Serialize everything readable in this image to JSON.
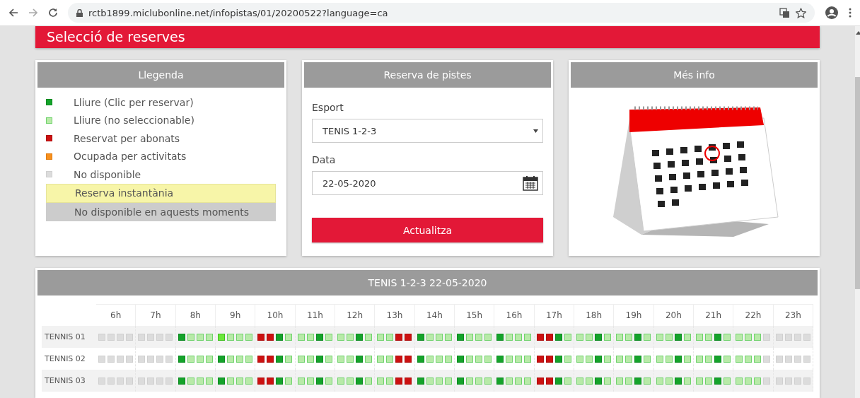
{
  "browser": {
    "url": "rctb1899.miclubonline.net/infopistas/01/20200522?language=ca"
  },
  "page_title": "Selecció de reserves",
  "legend": {
    "title": "Llegenda",
    "items": [
      {
        "kind": "free",
        "label": "Lliure (Clic per reservar)"
      },
      {
        "kind": "closed",
        "label": "Lliure (no seleccionable)"
      },
      {
        "kind": "booked",
        "label": "Reservat per abonats"
      },
      {
        "kind": "activity",
        "label": "Ocupada per activitats"
      },
      {
        "kind": "unavailable",
        "label": "No disponible"
      },
      {
        "kind": "instant",
        "label": "Reserva instantània"
      },
      {
        "kind": "blocked",
        "label": "No disponible en aquests moments"
      }
    ]
  },
  "booking": {
    "title": "Reserva de pistes",
    "sport_label": "Esport",
    "sport_value": "TENIS 1-2-3",
    "date_label": "Data",
    "date_value": "22-05-2020",
    "button": "Actualitza"
  },
  "info": {
    "title": "Més info"
  },
  "grid": {
    "title": "TENIS 1-2-3 22-05-2020",
    "hours": [
      "6h",
      "7h",
      "8h",
      "9h",
      "10h",
      "11h",
      "12h",
      "13h",
      "14h",
      "15h",
      "16h",
      "17h",
      "18h",
      "19h",
      "20h",
      "21h",
      "22h",
      "23h"
    ],
    "courts": [
      {
        "name": "TENNIS 01",
        "slots": [
          {
            "kind": "unavailable"
          },
          {
            "kind": "unavailable"
          },
          {
            "kind": "unavailable"
          },
          {
            "kind": "unavailable"
          },
          {
            "kind": "unavailable"
          },
          {
            "kind": "unavailable"
          },
          {
            "kind": "unavailable"
          },
          {
            "kind": "unavailable"
          },
          {
            "kind": "free"
          },
          {
            "kind": "closed"
          },
          {
            "kind": "closed"
          },
          {
            "kind": "closed"
          },
          {
            "kind": "highlight"
          },
          {
            "kind": "closed"
          },
          {
            "kind": "closed"
          },
          {
            "kind": "closed"
          },
          {
            "kind": "booked"
          },
          {
            "kind": "booked"
          },
          {
            "kind": "free"
          },
          {
            "kind": "closed"
          },
          {
            "kind": "closed"
          },
          {
            "kind": "closed"
          },
          {
            "kind": "free"
          },
          {
            "kind": "closed"
          },
          {
            "kind": "closed"
          },
          {
            "kind": "closed"
          },
          {
            "kind": "free"
          },
          {
            "kind": "closed"
          },
          {
            "kind": "closed"
          },
          {
            "kind": "closed"
          },
          {
            "kind": "booked"
          },
          {
            "kind": "booked"
          },
          {
            "kind": "free"
          },
          {
            "kind": "closed"
          },
          {
            "kind": "closed"
          },
          {
            "kind": "closed"
          },
          {
            "kind": "free"
          },
          {
            "kind": "closed"
          },
          {
            "kind": "closed"
          },
          {
            "kind": "closed"
          },
          {
            "kind": "free"
          },
          {
            "kind": "closed"
          },
          {
            "kind": "closed"
          },
          {
            "kind": "closed"
          },
          {
            "kind": "booked"
          },
          {
            "kind": "booked"
          },
          {
            "kind": "free"
          },
          {
            "kind": "closed"
          },
          {
            "kind": "closed"
          },
          {
            "kind": "closed"
          },
          {
            "kind": "free"
          },
          {
            "kind": "closed"
          },
          {
            "kind": "closed"
          },
          {
            "kind": "closed"
          },
          {
            "kind": "free"
          },
          {
            "kind": "closed"
          },
          {
            "kind": "closed"
          },
          {
            "kind": "closed"
          },
          {
            "kind": "free"
          },
          {
            "kind": "closed"
          },
          {
            "kind": "closed"
          },
          {
            "kind": "closed"
          },
          {
            "kind": "free"
          },
          {
            "kind": "closed"
          },
          {
            "kind": "closed"
          },
          {
            "kind": "closed"
          },
          {
            "kind": "closed"
          },
          {
            "kind": "unavailable"
          },
          {
            "kind": "unavailable"
          },
          {
            "kind": "unavailable"
          },
          {
            "kind": "unavailable"
          },
          {
            "kind": "unavailable"
          }
        ]
      },
      {
        "name": "TENNIS 02",
        "slots": [
          {
            "kind": "unavailable"
          },
          {
            "kind": "unavailable"
          },
          {
            "kind": "unavailable"
          },
          {
            "kind": "unavailable"
          },
          {
            "kind": "unavailable"
          },
          {
            "kind": "unavailable"
          },
          {
            "kind": "unavailable"
          },
          {
            "kind": "unavailable"
          },
          {
            "kind": "free"
          },
          {
            "kind": "closed"
          },
          {
            "kind": "closed"
          },
          {
            "kind": "closed"
          },
          {
            "kind": "free"
          },
          {
            "kind": "closed"
          },
          {
            "kind": "closed"
          },
          {
            "kind": "closed"
          },
          {
            "kind": "booked"
          },
          {
            "kind": "booked"
          },
          {
            "kind": "free"
          },
          {
            "kind": "closed"
          },
          {
            "kind": "closed"
          },
          {
            "kind": "closed"
          },
          {
            "kind": "free"
          },
          {
            "kind": "closed"
          },
          {
            "kind": "closed"
          },
          {
            "kind": "closed"
          },
          {
            "kind": "free"
          },
          {
            "kind": "closed"
          },
          {
            "kind": "closed"
          },
          {
            "kind": "closed"
          },
          {
            "kind": "booked"
          },
          {
            "kind": "booked"
          },
          {
            "kind": "free"
          },
          {
            "kind": "closed"
          },
          {
            "kind": "closed"
          },
          {
            "kind": "closed"
          },
          {
            "kind": "free"
          },
          {
            "kind": "closed"
          },
          {
            "kind": "closed"
          },
          {
            "kind": "closed"
          },
          {
            "kind": "free"
          },
          {
            "kind": "closed"
          },
          {
            "kind": "closed"
          },
          {
            "kind": "closed"
          },
          {
            "kind": "booked"
          },
          {
            "kind": "booked"
          },
          {
            "kind": "free"
          },
          {
            "kind": "closed"
          },
          {
            "kind": "closed"
          },
          {
            "kind": "closed"
          },
          {
            "kind": "free"
          },
          {
            "kind": "closed"
          },
          {
            "kind": "closed"
          },
          {
            "kind": "closed"
          },
          {
            "kind": "free"
          },
          {
            "kind": "closed"
          },
          {
            "kind": "closed"
          },
          {
            "kind": "closed"
          },
          {
            "kind": "free"
          },
          {
            "kind": "closed"
          },
          {
            "kind": "closed"
          },
          {
            "kind": "closed"
          },
          {
            "kind": "free"
          },
          {
            "kind": "closed"
          },
          {
            "kind": "closed"
          },
          {
            "kind": "closed"
          },
          {
            "kind": "closed"
          },
          {
            "kind": "unavailable"
          },
          {
            "kind": "unavailable"
          },
          {
            "kind": "unavailable"
          },
          {
            "kind": "unavailable"
          },
          {
            "kind": "unavailable"
          }
        ]
      },
      {
        "name": "TENNIS 03",
        "slots": [
          {
            "kind": "unavailable"
          },
          {
            "kind": "unavailable"
          },
          {
            "kind": "unavailable"
          },
          {
            "kind": "unavailable"
          },
          {
            "kind": "unavailable"
          },
          {
            "kind": "unavailable"
          },
          {
            "kind": "unavailable"
          },
          {
            "kind": "unavailable"
          },
          {
            "kind": "free"
          },
          {
            "kind": "closed"
          },
          {
            "kind": "closed"
          },
          {
            "kind": "closed"
          },
          {
            "kind": "free"
          },
          {
            "kind": "closed"
          },
          {
            "kind": "closed"
          },
          {
            "kind": "closed"
          },
          {
            "kind": "booked"
          },
          {
            "kind": "booked"
          },
          {
            "kind": "free"
          },
          {
            "kind": "closed"
          },
          {
            "kind": "closed"
          },
          {
            "kind": "closed"
          },
          {
            "kind": "free"
          },
          {
            "kind": "closed"
          },
          {
            "kind": "closed"
          },
          {
            "kind": "closed"
          },
          {
            "kind": "free"
          },
          {
            "kind": "closed"
          },
          {
            "kind": "closed"
          },
          {
            "kind": "closed"
          },
          {
            "kind": "booked"
          },
          {
            "kind": "booked"
          },
          {
            "kind": "free"
          },
          {
            "kind": "closed"
          },
          {
            "kind": "closed"
          },
          {
            "kind": "closed"
          },
          {
            "kind": "free"
          },
          {
            "kind": "closed"
          },
          {
            "kind": "closed"
          },
          {
            "kind": "closed"
          },
          {
            "kind": "free"
          },
          {
            "kind": "closed"
          },
          {
            "kind": "closed"
          },
          {
            "kind": "closed"
          },
          {
            "kind": "booked"
          },
          {
            "kind": "booked"
          },
          {
            "kind": "free"
          },
          {
            "kind": "closed"
          },
          {
            "kind": "closed"
          },
          {
            "kind": "closed"
          },
          {
            "kind": "free"
          },
          {
            "kind": "closed"
          },
          {
            "kind": "closed"
          },
          {
            "kind": "closed"
          },
          {
            "kind": "free"
          },
          {
            "kind": "closed"
          },
          {
            "kind": "closed"
          },
          {
            "kind": "closed"
          },
          {
            "kind": "free"
          },
          {
            "kind": "closed"
          },
          {
            "kind": "closed"
          },
          {
            "kind": "closed"
          },
          {
            "kind": "free"
          },
          {
            "kind": "closed"
          },
          {
            "kind": "closed"
          },
          {
            "kind": "closed"
          },
          {
            "kind": "closed"
          },
          {
            "kind": "unavailable"
          },
          {
            "kind": "unavailable"
          },
          {
            "kind": "unavailable"
          },
          {
            "kind": "unavailable"
          },
          {
            "kind": "unavailable"
          }
        ]
      }
    ]
  }
}
